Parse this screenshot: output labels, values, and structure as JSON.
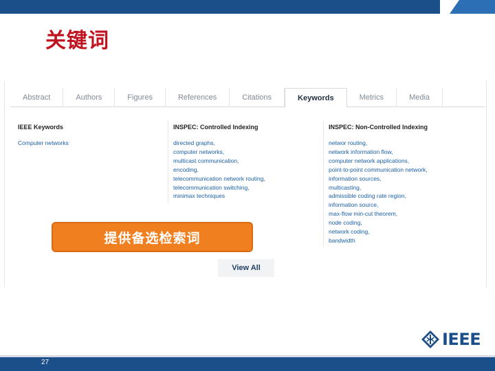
{
  "slide": {
    "title": "关键词",
    "page_number": "27"
  },
  "tabs": [
    {
      "label": "Abstract"
    },
    {
      "label": "Authors"
    },
    {
      "label": "Figures"
    },
    {
      "label": "References"
    },
    {
      "label": "Citations"
    },
    {
      "label": "Keywords",
      "active": true
    },
    {
      "label": "Metrics"
    },
    {
      "label": "Media"
    }
  ],
  "keywords": {
    "ieee": {
      "heading": "IEEE Keywords",
      "items": [
        "Computer networks"
      ]
    },
    "inspec_controlled": {
      "heading": "INSPEC: Controlled Indexing",
      "items": [
        "directed graphs,",
        "computer networks,",
        "multicast communication,",
        "encoding,",
        "telecommunication network routing,",
        "telecommunication switching,",
        "minimax techniques"
      ]
    },
    "inspec_noncontrolled": {
      "heading": "INSPEC: Non-Controlled Indexing",
      "items": [
        "networ routing,",
        "network information flow,",
        "computer network applications,",
        "point-to-point communication network,",
        "information sources,",
        "multicasting,",
        "admissible coding rate region,",
        "information source,",
        "max-flow min-cut theorem,",
        "node coding,",
        "network coding,",
        "bandwidth"
      ]
    }
  },
  "view_all_label": "View All",
  "callout_text": "提供备选检索词",
  "logo_text": "IEEE",
  "colors": {
    "brand_blue": "#1b4f8a",
    "title_red": "#c0121f",
    "callout_orange": "#f07f1f",
    "link_blue": "#1a5fa8"
  }
}
